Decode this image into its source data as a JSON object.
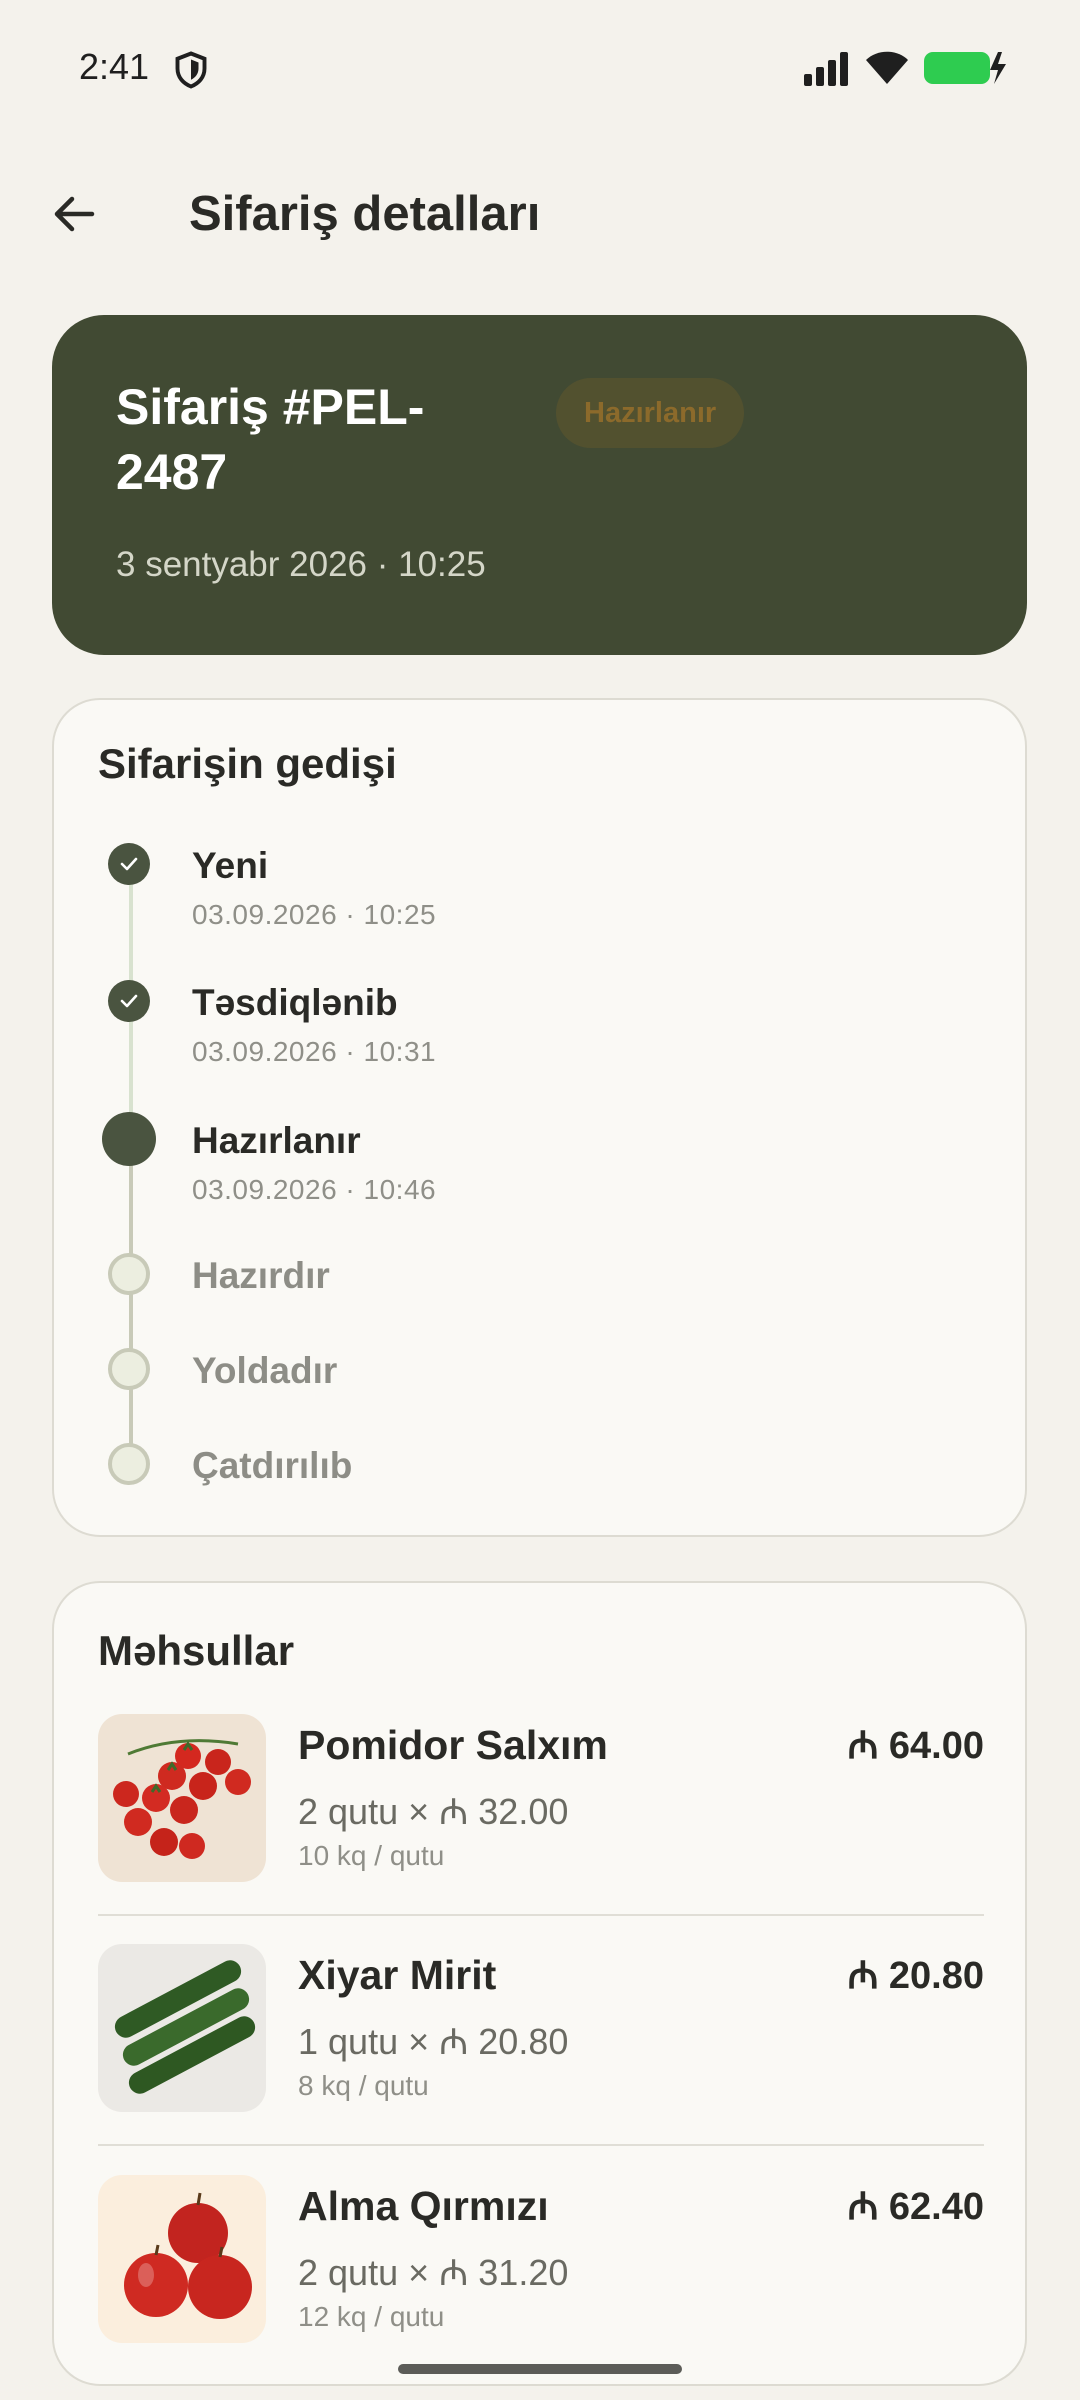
{
  "status_bar": {
    "time": "2:41"
  },
  "app_bar": {
    "title": "Sifariş detalları"
  },
  "order": {
    "title": "Sifariş #PEL-2487",
    "status": "Hazırlanır",
    "date": "3 sentyabr 2026 · 10:25"
  },
  "progress": {
    "title": "Sifarişin gedişi",
    "steps": [
      {
        "label": "Yeni",
        "time": "03.09.2026 · 10:25",
        "state": "done"
      },
      {
        "label": "Təsdiqlənib",
        "time": "03.09.2026 · 10:31",
        "state": "done"
      },
      {
        "label": "Hazırlanır",
        "time": "03.09.2026 · 10:46",
        "state": "current"
      },
      {
        "label": "Hazırdır",
        "state": "pending"
      },
      {
        "label": "Yoldadır",
        "state": "pending"
      },
      {
        "label": "Çatdırılıb",
        "state": "pending"
      }
    ]
  },
  "products": {
    "title": "Məhsullar",
    "items": [
      {
        "name": "Pomidor Salxım",
        "price": "₼ 64.00",
        "qty": "2 qutu × ₼ 32.00",
        "unit": "10 kq / qutu",
        "icon": "tomato-image"
      },
      {
        "name": "Xiyar Mirit",
        "price": "₼ 20.80",
        "qty": "1 qutu × ₼ 20.80",
        "unit": "8 kq / qutu",
        "icon": "cucumber-image"
      },
      {
        "name": "Alma Qırmızı",
        "price": "₼ 62.40",
        "qty": "2 qutu × ₼ 31.20",
        "unit": "12 kq / qutu",
        "icon": "apple-image"
      }
    ]
  },
  "colors": {
    "header_bg": "#414a33",
    "accent": "#4a5440",
    "status_badge": "#8c6a2b",
    "battery": "#2ecc50"
  }
}
